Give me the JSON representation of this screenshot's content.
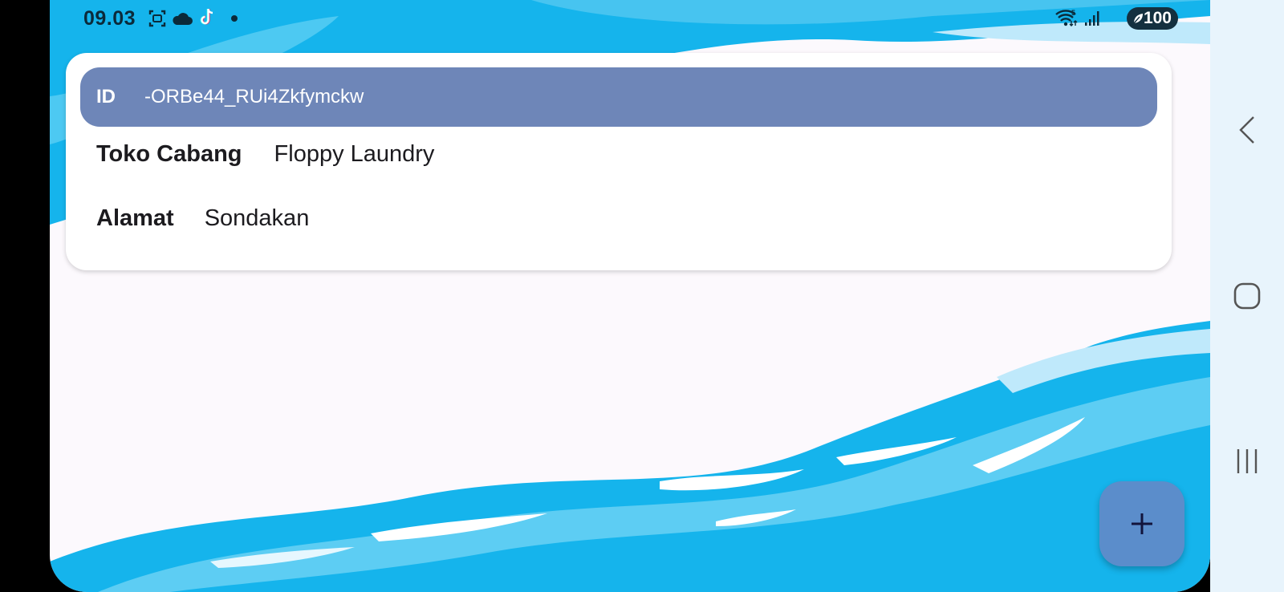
{
  "status_bar": {
    "time": "09.03",
    "battery": "100",
    "icons": [
      "screenshot-icon",
      "cloud-icon",
      "tiktok-icon",
      "notification-dot-icon",
      "wifi-icon",
      "signal-icon",
      "battery-icon"
    ]
  },
  "store": {
    "id_label": "ID",
    "id_value": "-ORBe44_RUi4Zkfymckw",
    "branch_label": "Toko Cabang",
    "branch_value": "Floppy Laundry",
    "address_label": "Alamat",
    "address_value": "Sondakan"
  },
  "fab": {
    "icon": "plus-icon"
  },
  "nav": {
    "icons": [
      "back-icon",
      "home-icon",
      "recents-icon"
    ]
  },
  "colors": {
    "accent": "#6e86b8",
    "fab": "#5b8dcb",
    "water": "#1cb5ec"
  }
}
